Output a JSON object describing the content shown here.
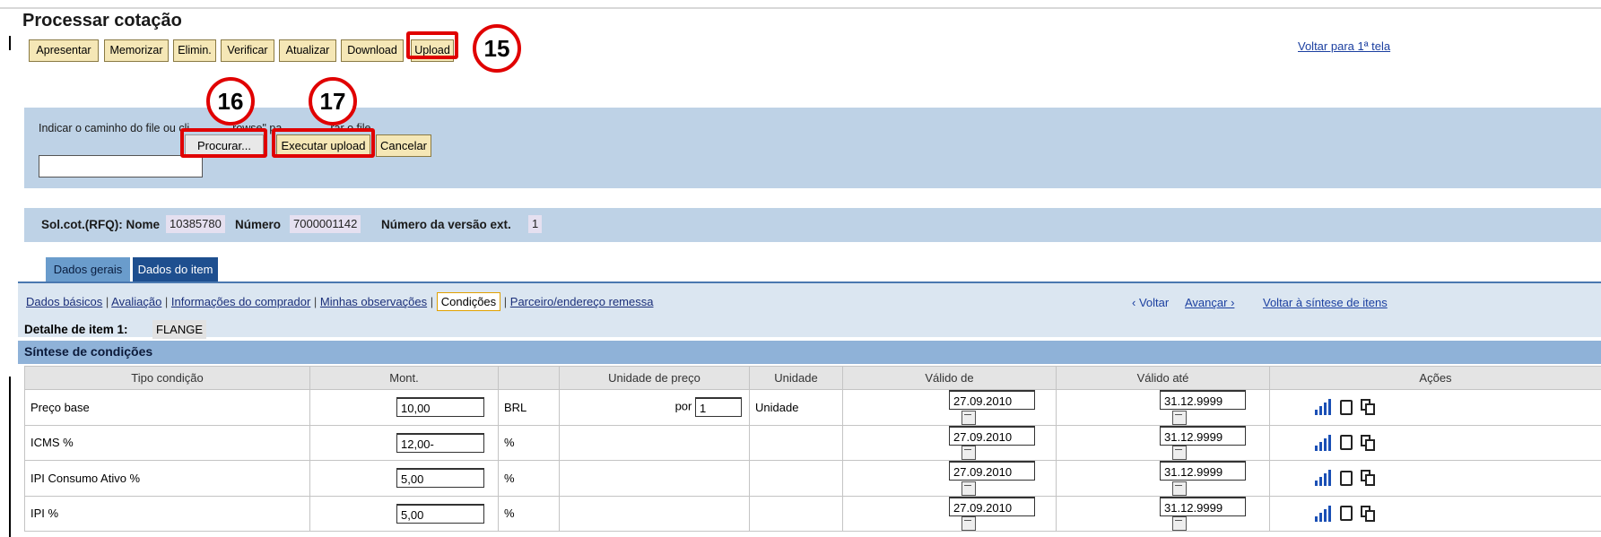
{
  "page": {
    "title": "Processar cotação",
    "back_first": "Voltar para 1ª tela"
  },
  "toolbar": [
    "Apresentar",
    "Memorizar",
    "Elimin.",
    "Verificar",
    "Atualizar",
    "Download",
    "Upload"
  ],
  "callouts": [
    "15",
    "16",
    "17"
  ],
  "upload": {
    "hint": "Indicar o caminho do file ou clicar em \"Browse\" para procurar o file.",
    "hint_left": "Indicar o caminho do file ou cli",
    "hint_mid": "rowse\" pa",
    "hint_right": "rar o file.",
    "file_value": "",
    "browse": "Procurar...",
    "execute": "Executar upload",
    "cancel": "Cancelar"
  },
  "rfq": {
    "name_label": "Sol.cot.(RFQ): Nome",
    "name_value": "10385780",
    "number_label": "Número",
    "number_value": "7000001142",
    "version_label": "Número da versão ext.",
    "version_value": "1"
  },
  "tabs": [
    "Dados gerais",
    "Dados do item"
  ],
  "sublinks": [
    "Dados básicos",
    "Avaliação",
    "Informações do comprador",
    "Minhas observações",
    "Condições",
    "Parceiro/endereço remessa"
  ],
  "nav": {
    "back": "‹ Voltar",
    "forward": "Avançar ›",
    "summary": "Voltar à síntese de itens"
  },
  "detail": {
    "label": "Detalhe de item 1:",
    "value": "FLANGE"
  },
  "synthesis_title": "Síntese de condições",
  "table": {
    "columns": [
      "Tipo condição",
      "Mont.",
      "",
      "Unidade de preço",
      "Unidade",
      "Válido de",
      "Válido até",
      "Ações"
    ],
    "rows": [
      {
        "type": "Preço base",
        "amount": "10,00",
        "unit": "BRL",
        "per_label": "por",
        "per_value": "1",
        "uom": "Unidade",
        "from": "27.09.2010",
        "to": "31.12.9999"
      },
      {
        "type": "ICMS %",
        "amount": "12,00-",
        "unit": "%",
        "per_label": "",
        "per_value": "",
        "uom": "",
        "from": "27.09.2010",
        "to": "31.12.9999"
      },
      {
        "type": "IPI Consumo Ativo %",
        "amount": "5,00",
        "unit": "%",
        "per_label": "",
        "per_value": "",
        "uom": "",
        "from": "27.09.2010",
        "to": "31.12.9999"
      },
      {
        "type": "IPI %",
        "amount": "5,00",
        "unit": "%",
        "per_label": "",
        "per_value": "",
        "uom": "",
        "from": "27.09.2010",
        "to": "31.12.9999"
      }
    ]
  },
  "icons": {
    "calendar": "calendar-icon",
    "chart": "bar-chart-icon",
    "delete": "trash-icon",
    "copy": "copy-icon"
  },
  "colors": {
    "highlight": "#e00000",
    "button_bg": "#f5e7b6",
    "panel_bg": "#bed2e6",
    "tab_active": "#1e4f8f",
    "link": "#1b3fa0"
  }
}
